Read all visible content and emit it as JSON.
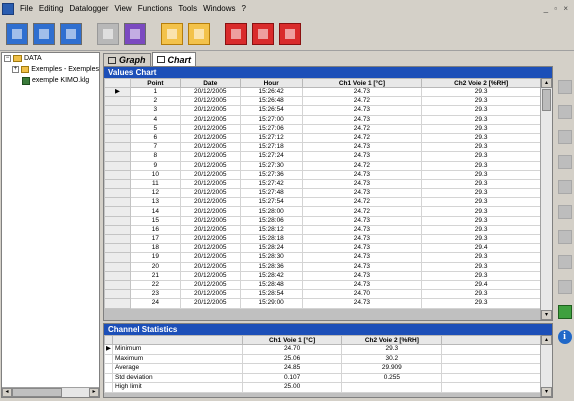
{
  "menubar": {
    "items": [
      "File",
      "Editing",
      "Datalogger",
      "View",
      "Functions",
      "Tools",
      "Windows",
      "?"
    ],
    "window_controls": "_ ▫ ×"
  },
  "tree": {
    "root_label": "DATA",
    "folder_label": "Exemples - Exemples",
    "file_label": "exemple KIMO.klg"
  },
  "tabs": [
    {
      "label": "Graph"
    },
    {
      "label": "Chart"
    }
  ],
  "values_chart": {
    "title": "Values Chart",
    "columns": [
      "Point",
      "Date",
      "Hour",
      "Ch1 Voie 1 [°C]",
      "Ch2 Voie 2 [%RH]"
    ],
    "rows": [
      [
        "1",
        "20/12/2005",
        "15:26:42",
        "24.73",
        "29.3"
      ],
      [
        "2",
        "20/12/2005",
        "15:26:48",
        "24.72",
        "29.3"
      ],
      [
        "3",
        "20/12/2005",
        "15:26:54",
        "24.73",
        "29.3"
      ],
      [
        "4",
        "20/12/2005",
        "15:27:00",
        "24.73",
        "29.3"
      ],
      [
        "5",
        "20/12/2005",
        "15:27:06",
        "24.72",
        "29.3"
      ],
      [
        "6",
        "20/12/2005",
        "15:27:12",
        "24.72",
        "29.3"
      ],
      [
        "7",
        "20/12/2005",
        "15:27:18",
        "24.73",
        "29.3"
      ],
      [
        "8",
        "20/12/2005",
        "15:27:24",
        "24.73",
        "29.3"
      ],
      [
        "9",
        "20/12/2005",
        "15:27:30",
        "24.72",
        "29.3"
      ],
      [
        "10",
        "20/12/2005",
        "15:27:36",
        "24.73",
        "29.3"
      ],
      [
        "11",
        "20/12/2005",
        "15:27:42",
        "24.73",
        "29.3"
      ],
      [
        "12",
        "20/12/2005",
        "15:27:48",
        "24.73",
        "29.3"
      ],
      [
        "13",
        "20/12/2005",
        "15:27:54",
        "24.72",
        "29.3"
      ],
      [
        "14",
        "20/12/2005",
        "15:28:00",
        "24.72",
        "29.3"
      ],
      [
        "15",
        "20/12/2005",
        "15:28:06",
        "24.73",
        "29.3"
      ],
      [
        "16",
        "20/12/2005",
        "15:28:12",
        "24.73",
        "29.3"
      ],
      [
        "17",
        "20/12/2005",
        "15:28:18",
        "24.73",
        "29.3"
      ],
      [
        "18",
        "20/12/2005",
        "15:28:24",
        "24.73",
        "29.4"
      ],
      [
        "19",
        "20/12/2005",
        "15:28:30",
        "24.73",
        "29.3"
      ],
      [
        "20",
        "20/12/2005",
        "15:28:36",
        "24.73",
        "29.3"
      ],
      [
        "21",
        "20/12/2005",
        "15:28:42",
        "24.73",
        "29.3"
      ],
      [
        "22",
        "20/12/2005",
        "15:28:48",
        "24.73",
        "29.4"
      ],
      [
        "23",
        "20/12/2005",
        "15:28:54",
        "24.70",
        "29.3"
      ],
      [
        "24",
        "20/12/2005",
        "15:29:00",
        "24.73",
        "29.3"
      ]
    ]
  },
  "channel_statistics": {
    "title": "Channel Statistics",
    "columns": [
      "",
      "Ch1 Voie 1 [°C]",
      "Ch2 Voie 2 [%RH]"
    ],
    "rows": [
      [
        "Minimum",
        "24.70",
        "29.3"
      ],
      [
        "Maximum",
        "25.06",
        "30.2"
      ],
      [
        "Average",
        "24.85",
        "29.909"
      ],
      [
        "Std deviation",
        "0.107",
        "0.255"
      ],
      [
        "High limit",
        "25.00",
        ""
      ]
    ]
  },
  "colors": {
    "panel_title_bg": "#1c4fb8",
    "window_bg": "#d4d0c8"
  },
  "icons": {
    "toolbar": [
      "open-folder-icon",
      "new-document-icon",
      "save-icon",
      "disabled-icon",
      "edit-icon",
      "report-icon",
      "print-icon",
      "download-icon",
      "configure-icon",
      "export-icon"
    ],
    "rightbar": [
      "zoom-in-icon",
      "zoom-out-icon",
      "pan-icon",
      "cursor-icon",
      "crosshair-icon",
      "tool-icon",
      "tool-icon",
      "tool-icon",
      "hand-icon",
      "chart-icon",
      "info-icon"
    ]
  }
}
